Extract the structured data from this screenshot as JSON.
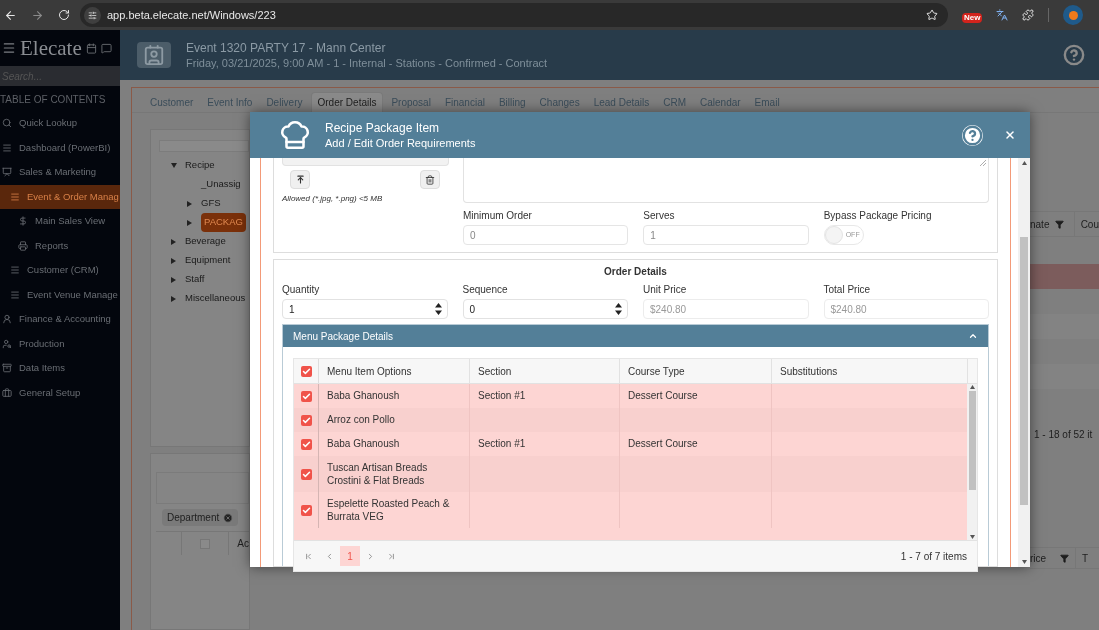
{
  "browser": {
    "url": "app.beta.elecate.net/Windows/223",
    "extension_badge": "New"
  },
  "sidebar": {
    "brand": "Elecate",
    "search": {
      "placeholder": "Search..."
    },
    "heading": "TABLE OF CONTENTS",
    "items": [
      {
        "label": "Quick Lookup",
        "selected": false
      },
      {
        "label": "Dashboard (PowerBI)",
        "selected": false
      },
      {
        "label": "Sales & Marketing",
        "selected": false,
        "children": [
          {
            "label": "Event & Order Manag",
            "selected": true,
            "children": [
              {
                "label": "Main Sales View",
                "selected": false
              },
              {
                "label": "Reports",
                "selected": false
              }
            ]
          },
          {
            "label": "Customer (CRM)",
            "selected": false
          },
          {
            "label": "Event Venue Manage",
            "selected": false
          }
        ]
      },
      {
        "label": "Finance & Accounting",
        "selected": false
      },
      {
        "label": "Production",
        "selected": false
      },
      {
        "label": "Data Items",
        "selected": false
      },
      {
        "label": "General Setup",
        "selected": false
      }
    ]
  },
  "header": {
    "title": "Event 1320 PARTY 17 - Mann Center",
    "subtitle": "Friday, 03/21/2025, 9:00 AM - 1 - Internal - Stations - Confirmed - Contract"
  },
  "tabs": [
    {
      "label": "Customer",
      "selected": false
    },
    {
      "label": "Event Info",
      "selected": false
    },
    {
      "label": "Delivery",
      "selected": false
    },
    {
      "label": "Order Details",
      "selected": true
    },
    {
      "label": "Proposal",
      "selected": false
    },
    {
      "label": "Financial",
      "selected": false
    },
    {
      "label": "Billing",
      "selected": false
    },
    {
      "label": "Changes",
      "selected": false
    },
    {
      "label": "Lead Details",
      "selected": false
    },
    {
      "label": "CRM",
      "selected": false
    },
    {
      "label": "Calendar",
      "selected": false
    },
    {
      "label": "Email",
      "selected": false
    }
  ],
  "tree": [
    {
      "label": "Recipe",
      "kind": "folder",
      "expanded": true,
      "selected": false,
      "children": [
        {
          "label": "_Unassig",
          "kind": "leaf",
          "selected": false
        },
        {
          "label": "GFS",
          "kind": "folder",
          "expanded": false,
          "selected": false
        },
        {
          "label": "PACKAG",
          "kind": "folder",
          "expanded": false,
          "selected": true
        }
      ]
    },
    {
      "label": "Beverage",
      "kind": "folder",
      "expanded": false,
      "selected": false
    },
    {
      "label": "Equipment",
      "kind": "folder",
      "expanded": false,
      "selected": false
    },
    {
      "label": "Staff",
      "kind": "folder",
      "expanded": false,
      "selected": false
    },
    {
      "label": "Miscellaneous",
      "kind": "folder",
      "expanded": false,
      "selected": false
    }
  ],
  "upper_grid": {
    "columns": [
      "nate",
      "Cou"
    ],
    "pager": "1 - 18 of 52 it"
  },
  "lower_grid": {
    "chip": "Department",
    "select_all_checked": false,
    "left_column": "Ac",
    "right_columns": [
      "rice",
      "T"
    ]
  },
  "modal": {
    "title": "Recipe Package Item",
    "subtitle": "Add / Edit Order Requirements",
    "image_note": "Allowed (*.jpg, *.png) <5 MB",
    "fields": [
      {
        "label": "Minimum Order",
        "value": "0",
        "disabled": true
      },
      {
        "label": "Serves",
        "value": "1",
        "disabled": true
      }
    ],
    "bypass": {
      "label": "Bypass Package Pricing",
      "on": false,
      "state_text": "OFF"
    },
    "order_details": {
      "heading": "Order Details",
      "fields": [
        {
          "label": "Quantity",
          "value": "1",
          "kind": "spinner"
        },
        {
          "label": "Sequence",
          "value": "0",
          "kind": "spinner"
        },
        {
          "label": "Unit Price",
          "value": "$240.80",
          "kind": "readonly",
          "disabled": true
        },
        {
          "label": "Total Price",
          "value": "$240.80",
          "kind": "readonly",
          "disabled": true
        }
      ]
    },
    "menu_package": {
      "title": "Menu Package Details",
      "expanded": true,
      "header_checked": true,
      "columns": [
        "Menu Item Options",
        "Section",
        "Course Type",
        "Substitutions"
      ],
      "rows": [
        {
          "checked": true,
          "option": "Baba Ghanoush",
          "section": "Section #1",
          "course_type": "Dessert Course"
        },
        {
          "checked": true,
          "option": "Arroz con Pollo"
        },
        {
          "checked": true,
          "option": "Baba Ghanoush",
          "section": "Section #1",
          "course_type": "Dessert Course"
        },
        {
          "checked": true,
          "option": "Tuscan Artisan Breads Crostini & Flat Breads"
        },
        {
          "checked": true,
          "option": "Espelette Roasted Peach & Burrata VEG"
        }
      ],
      "pager": {
        "pages": [
          {
            "label": "1",
            "selected": true
          }
        ],
        "summary": "1 - 7 of 7 items"
      }
    }
  }
}
